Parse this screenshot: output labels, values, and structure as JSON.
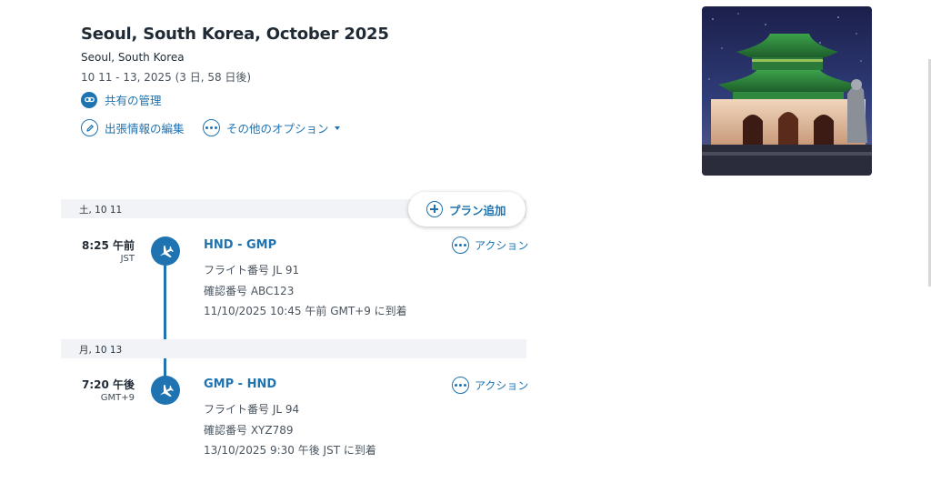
{
  "trip": {
    "title": "Seoul, South Korea, October 2025",
    "location": "Seoul, South Korea",
    "dates": "10 11 - 13, 2025 (3 日, 58 日後)",
    "share_label": "共有の管理",
    "edit_label": "出張情報の編集",
    "more_options_label": "その他のオプション"
  },
  "add_plan_label": "プラン追加",
  "days": [
    {
      "label": "土, 10 11",
      "flight": {
        "time": "8:25 午前",
        "timezone": "JST",
        "route": "HND - GMP",
        "flight_number": "フライト番号 JL 91",
        "confirmation": "確認番号 ABC123",
        "arrival": "11/10/2025 10:45 午前 GMT+9 に到着",
        "action_label": "アクション"
      }
    },
    {
      "label": "月, 10 13",
      "flight": {
        "time": "7:20 午後",
        "timezone": "GMT+9",
        "route": "GMP - HND",
        "flight_number": "フライト番号 JL 94",
        "confirmation": "確認番号 XYZ789",
        "arrival": "13/10/2025 9:30 午後 JST に到着",
        "action_label": "アクション"
      }
    }
  ],
  "colors": {
    "accent": "#1e73b0",
    "day_bar": "#f2f3f6",
    "text": "#1f2a35"
  },
  "icons": {
    "share": "link-icon",
    "edit": "pencil-icon",
    "more": "more-dots-icon",
    "add": "plus-circle-icon",
    "flight": "airplane-icon",
    "action": "more-dots-icon"
  }
}
